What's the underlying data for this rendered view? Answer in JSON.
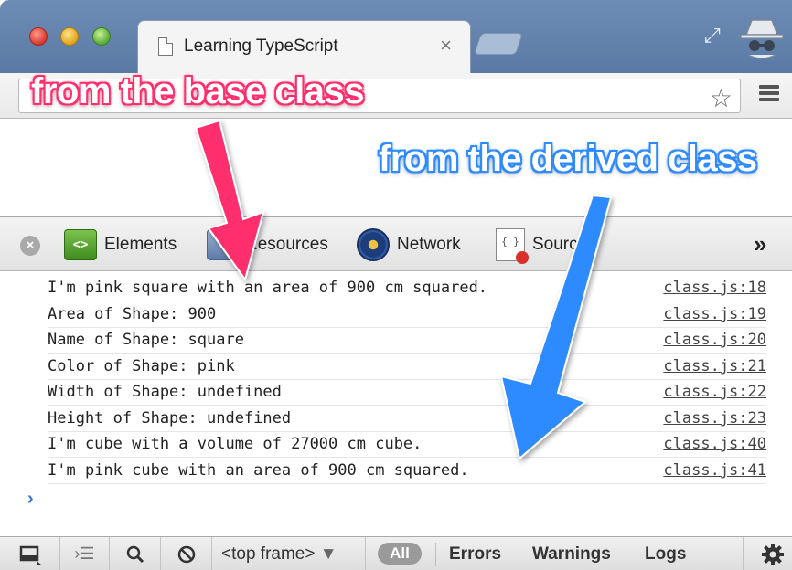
{
  "window": {
    "tab_title": "Learning TypeScript",
    "tab_close": "×",
    "icons": {
      "tab_doc": "document-icon",
      "fullscreen": "fullscreen-icon",
      "incognito": "incognito-icon",
      "star": "star-icon",
      "menu": "hamburger-menu-icon"
    }
  },
  "devtools": {
    "tabs": [
      {
        "label": "Elements",
        "icon": "elements-icon"
      },
      {
        "label": "Resources",
        "icon": "resources-icon"
      },
      {
        "label": "Network",
        "icon": "network-icon"
      },
      {
        "label": "Sources",
        "icon": "sources-icon"
      }
    ],
    "more": "»"
  },
  "console": {
    "rows": [
      {
        "message": "I'm pink square with an area of 900 cm squared.",
        "source": "class.js:18"
      },
      {
        "message": "Area of Shape: 900",
        "source": "class.js:19"
      },
      {
        "message": "Name of Shape: square",
        "source": "class.js:20"
      },
      {
        "message": "Color of Shape: pink",
        "source": "class.js:21"
      },
      {
        "message": "Width of Shape: undefined",
        "source": "class.js:22"
      },
      {
        "message": "Height of Shape: undefined",
        "source": "class.js:23"
      },
      {
        "message": "I'm cube with a volume of 27000 cm cube.",
        "source": "class.js:40"
      },
      {
        "message": "I'm pink cube with an area of 900 cm squared.",
        "source": "class.js:41"
      }
    ],
    "prompt": "›"
  },
  "statusbar": {
    "frame": "<top frame>",
    "filters": {
      "all": "All",
      "errors": "Errors",
      "warnings": "Warnings",
      "logs": "Logs"
    }
  },
  "annotations": {
    "base": "from the base class",
    "derived": "from the derived class"
  },
  "colors": {
    "annotation_pink": "#ff2f6d",
    "annotation_blue": "#2f8bff",
    "link": "#444444"
  }
}
